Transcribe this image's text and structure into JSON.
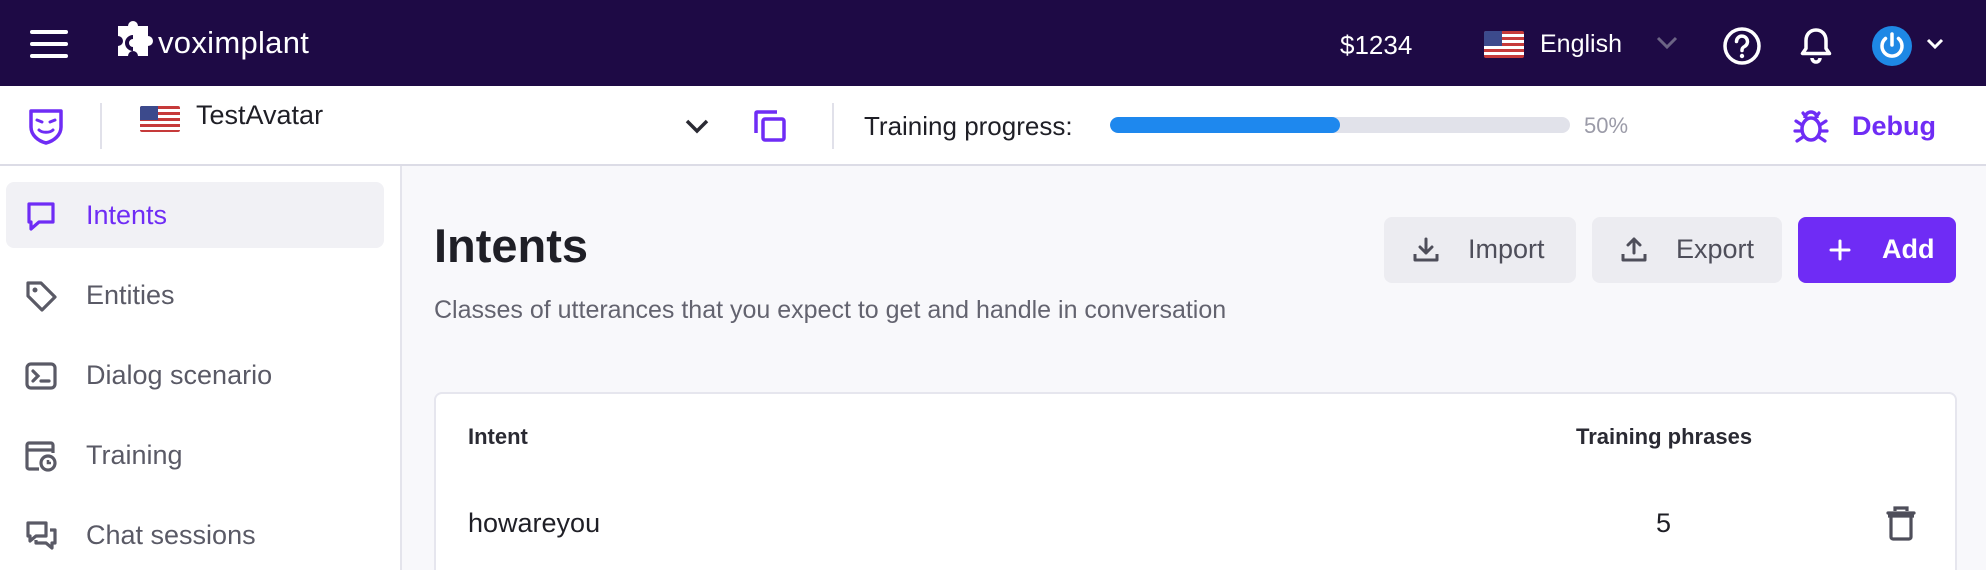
{
  "header": {
    "brand": "voximplant",
    "balance": "$1234",
    "language": "English",
    "icons": [
      "menu-icon",
      "voximplant-logo",
      "us-flag-icon",
      "chevron-down-icon",
      "help-icon",
      "bell-icon",
      "power-avatar-icon",
      "chevron-down-icon"
    ]
  },
  "subheader": {
    "project_name": "TestAvatar",
    "training_label": "Training progress:",
    "training_percent": "50%",
    "training_progress": 0.5,
    "debug_label": "Debug",
    "icons": [
      "mask-icon",
      "us-flag-icon",
      "chevron-down-icon",
      "copy-icon",
      "bug-icon"
    ]
  },
  "sidebar": {
    "items": [
      {
        "label": "Intents",
        "icon": "chat-bubble-icon",
        "active": true
      },
      {
        "label": "Entities",
        "icon": "tag-icon",
        "active": false
      },
      {
        "label": "Dialog scenario",
        "icon": "terminal-icon",
        "active": false
      },
      {
        "label": "Training",
        "icon": "training-clock-icon",
        "active": false
      },
      {
        "label": "Chat sessions",
        "icon": "chat-sessions-icon",
        "active": false
      }
    ]
  },
  "main": {
    "title": "Intents",
    "subtitle": "Classes of utterances that you expect to get and handle in conversation",
    "buttons": {
      "import": "Import",
      "export": "Export",
      "add": "Add"
    },
    "table": {
      "columns": [
        "Intent",
        "Training phrases"
      ],
      "rows": [
        {
          "intent": "howareyou",
          "phrases": "5"
        }
      ]
    }
  },
  "colors": {
    "topbar_bg": "#1e0a45",
    "accent": "#6f2cf5",
    "progress": "#1e88ee"
  }
}
